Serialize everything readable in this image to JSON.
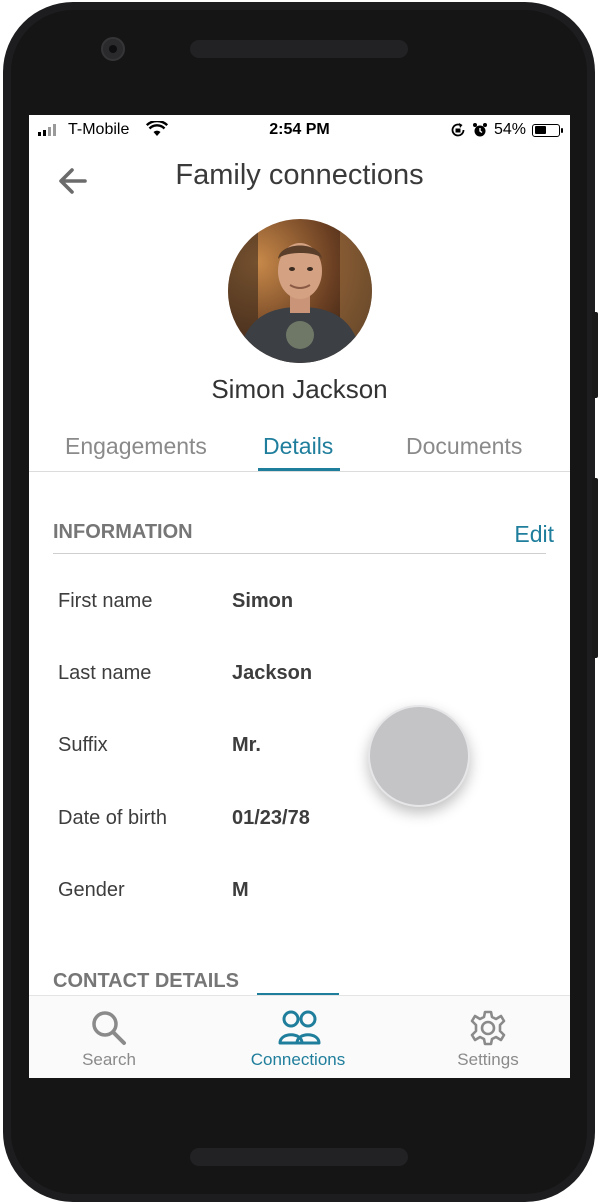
{
  "status_bar": {
    "carrier": "T-Mobile",
    "time": "2:54 PM",
    "battery_percent": "54%",
    "battery_level": 0.54,
    "icons": [
      "signal-icon",
      "wifi-icon",
      "orientation-lock-icon",
      "alarm-icon",
      "battery-icon"
    ]
  },
  "header": {
    "title": "Family connections",
    "back_icon": "arrow-left-icon"
  },
  "profile": {
    "name": "Simon Jackson"
  },
  "tabs": [
    {
      "label": "Engagements",
      "active": false
    },
    {
      "label": "Details",
      "active": true
    },
    {
      "label": "Documents",
      "active": false
    }
  ],
  "information": {
    "title": "INFORMATION",
    "edit_label": "Edit",
    "rows": [
      {
        "label": "First name",
        "value": "Simon"
      },
      {
        "label": "Last name",
        "value": "Jackson"
      },
      {
        "label": "Suffix",
        "value": "Mr."
      },
      {
        "label": "Date of birth",
        "value": "01/23/78"
      },
      {
        "label": "Gender",
        "value": "M"
      }
    ]
  },
  "contact_details": {
    "title": "CONTACT DETAILS"
  },
  "bottom_nav": [
    {
      "label": "Search",
      "icon": "search-icon",
      "active": false
    },
    {
      "label": "Connections",
      "icon": "people-icon",
      "active": true
    },
    {
      "label": "Settings",
      "icon": "gear-icon",
      "active": false
    }
  ],
  "colors": {
    "accent": "#1f7e9c",
    "text": "#3d3d3d",
    "muted": "#8a8a8a"
  }
}
